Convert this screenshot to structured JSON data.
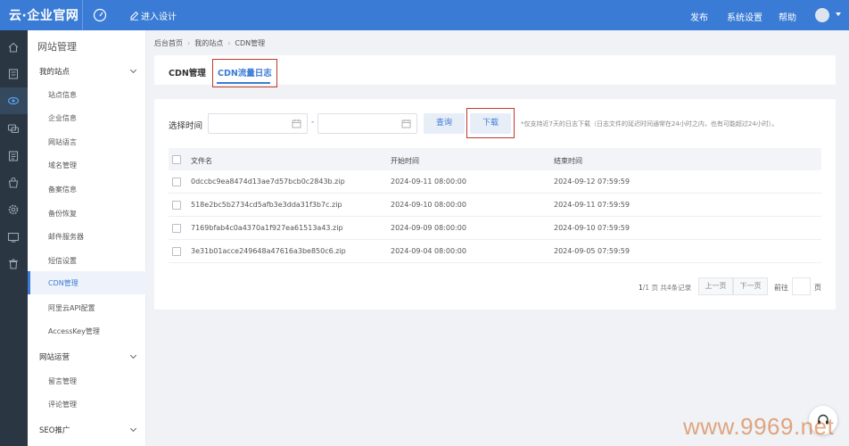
{
  "topbar": {
    "logo": "云·企业官网",
    "design_label": "进入设计",
    "menu": [
      "发布",
      "系统设置",
      "帮助"
    ]
  },
  "sidebar": {
    "title": "网站管理",
    "groups": [
      {
        "label": "我的站点",
        "items": [
          "站点信息",
          "企业信息",
          "网站语言",
          "域名管理",
          "备案信息",
          "备份恢复",
          "邮件服务器",
          "短信设置",
          "CDN管理",
          "阿里云API配置",
          "AccessKey管理"
        ]
      },
      {
        "label": "网站运营",
        "items": [
          "留言管理",
          "评论管理"
        ]
      },
      {
        "label": "SEO推广",
        "items": []
      }
    ],
    "active_item": "CDN管理"
  },
  "breadcrumb": [
    "后台首页",
    "我的站点",
    "CDN管理"
  ],
  "tabs": [
    {
      "label": "CDN管理",
      "active": false
    },
    {
      "label": "CDN流量日志",
      "active": true
    }
  ],
  "filter": {
    "label": "选择时间",
    "start_value": "",
    "end_value": "",
    "separator": "-",
    "query_label": "查询",
    "download_label": "下载",
    "note": "*仅支持近7天的日志下载（日志文件的延迟时间通常在24小时之内，也有可能超过24小时）。"
  },
  "table": {
    "headers": [
      "文件名",
      "开始时间",
      "结束时间"
    ],
    "rows": [
      {
        "file": "0dccbc9ea8474d13ae7d57bcb0c2843b.zip",
        "start": "2024-09-11 08:00:00",
        "end": "2024-09-12 07:59:59"
      },
      {
        "file": "518e2bc5b2734cd5afb3e3dda31f3b7c.zip",
        "start": "2024-09-10 08:00:00",
        "end": "2024-09-11 07:59:59"
      },
      {
        "file": "7169bfab4c0a4370a1f927ea61513a43.zip",
        "start": "2024-09-09 08:00:00",
        "end": "2024-09-10 07:59:59"
      },
      {
        "file": "3e31b01acce249648a47616a3be850c6.zip",
        "start": "2024-09-04 08:00:00",
        "end": "2024-09-05 07:59:59"
      }
    ]
  },
  "pagination": {
    "current": "1",
    "total_pages": "/1 页",
    "records": "共4条记录",
    "prev_label": "上一页",
    "next_label": "下一页",
    "goto_label": "前往",
    "goto_value": "",
    "page_suffix": "页"
  },
  "watermark": "www.9969.net",
  "colors": {
    "accent": "#3a7bd5",
    "highlight_box": "#c0392b",
    "sidebar_dark": "#2b3643"
  }
}
